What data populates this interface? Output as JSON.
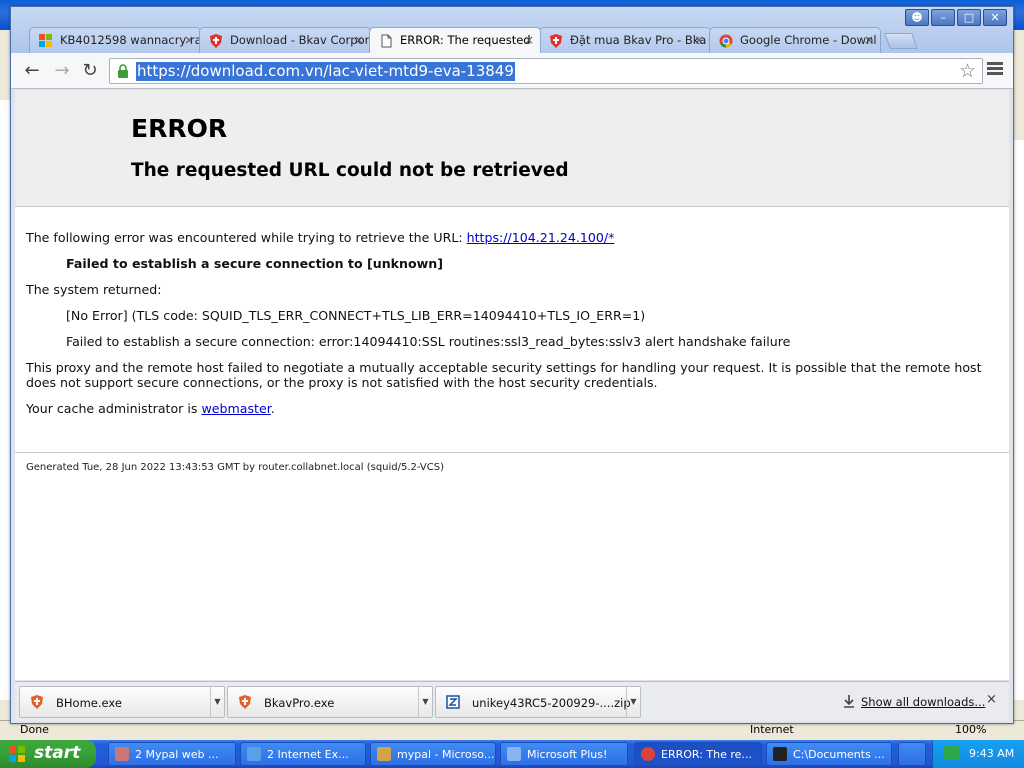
{
  "background_window": {
    "status_done": "Done",
    "status_zone": "Internet",
    "status_zoom": "100%"
  },
  "browser": {
    "tabs": [
      {
        "label": "KB4012598 wannacry ra",
        "icon": "windows-flag-icon",
        "active": false
      },
      {
        "label": "Download - Bkav Corpor",
        "icon": "bkav-shield-icon",
        "active": false
      },
      {
        "label": "ERROR: The requested",
        "icon": "page-icon",
        "active": true
      },
      {
        "label": "Đặt mua Bkav Pro - Bka",
        "icon": "bkav-shield-icon",
        "active": false
      },
      {
        "label": "Google Chrome - Downl",
        "icon": "chrome-logo-icon",
        "active": false
      }
    ],
    "tab_close_glyph": "×",
    "address": "https://download.com.vn/lac-viet-mtd9-eva-13849"
  },
  "page": {
    "title": "ERROR",
    "subtitle": "The requested URL could not be retrieved",
    "intro": "The following error was encountered while trying to retrieve the URL: ",
    "intro_link": "https://104.21.24.100/*",
    "failure": "Failed to establish a secure connection to [unknown]",
    "system_returned": "The system returned:",
    "tls_code": "[No Error] (TLS code: SQUID_TLS_ERR_CONNECT+TLS_LIB_ERR=14094410+TLS_IO_ERR=1)",
    "ssl_detail": "Failed to establish a secure connection: error:14094410:SSL routines:ssl3_read_bytes:sslv3 alert handshake failure",
    "explanation": "This proxy and the remote host failed to negotiate a mutually acceptable security settings for handling your request. It is possible that the remote host does not support secure connections, or the proxy is not satisfied with the host security credentials.",
    "admin_prefix": "Your cache administrator is ",
    "admin_link": "webmaster",
    "admin_suffix": ".",
    "footer": "Generated Tue, 28 Jun 2022 13:43:53 GMT by router.collabnet.local (squid/5.2-VCS)"
  },
  "downloads": {
    "items": [
      {
        "name": "BHome.exe",
        "icon": "bkav-shield-icon"
      },
      {
        "name": "BkavPro.exe",
        "icon": "bkav-shield-icon"
      },
      {
        "name": "unikey43RC5-200929-....zip",
        "icon": "zip-file-icon"
      }
    ],
    "show_all": "Show all downloads...",
    "close_glyph": "×"
  },
  "taskbar": {
    "start_label": "start",
    "items": [
      {
        "label": "2 Mypal web ...",
        "icon": "mypal-icon",
        "active": false
      },
      {
        "label": "2 Internet Ex...",
        "icon": "ie-icon",
        "active": false
      },
      {
        "label": "mypal - Microso...",
        "icon": "paint-icon",
        "active": false
      },
      {
        "label": "Microsoft Plus!",
        "icon": "plus-icon",
        "active": false
      },
      {
        "label": "ERROR: The re...",
        "icon": "chrome-logo-icon",
        "active": true
      },
      {
        "label": "C:\\Documents ...",
        "icon": "7zip-icon",
        "active": false
      }
    ],
    "clock": "9:43 AM"
  },
  "colors": {
    "url_highlight": "#3875d7",
    "link": "#0000cc",
    "taskbar": "#245edb",
    "start": "#38a438"
  }
}
